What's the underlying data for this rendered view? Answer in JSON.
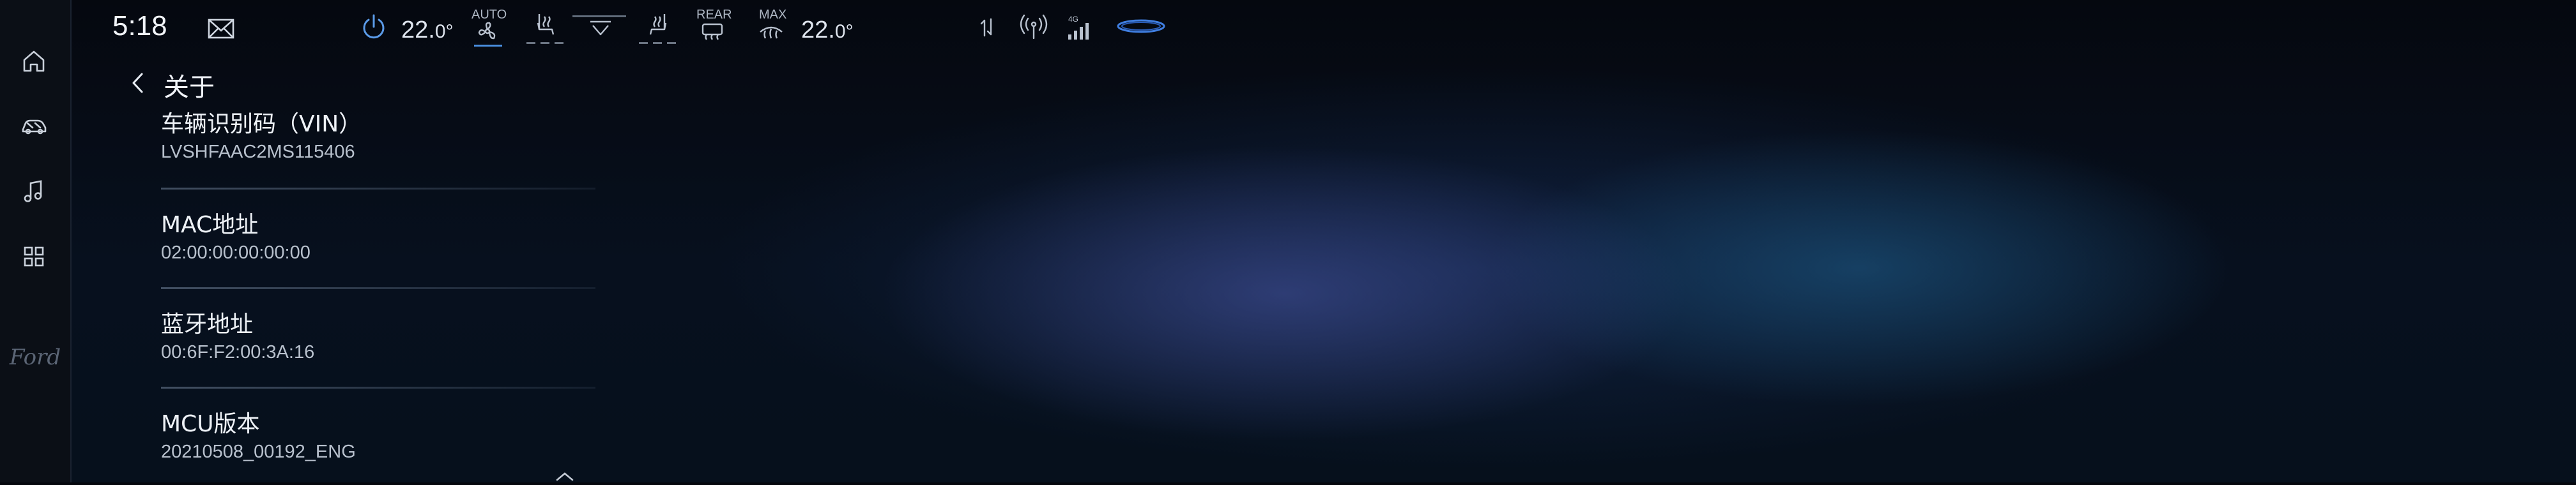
{
  "status_bar": {
    "time": "5:18",
    "mail_icon": "mail-icon",
    "power_icon": "power-icon",
    "driver_temp_main": "22.",
    "driver_temp_decimal": "0°",
    "auto_label": "AUTO",
    "rear_label": "REAR",
    "max_label": "MAX",
    "passenger_temp_main": "22.",
    "passenger_temp_decimal": "0°",
    "accent_color": "#4a8fe0"
  },
  "sidebar": {
    "items": [
      {
        "name": "home",
        "icon": "home-icon"
      },
      {
        "name": "vehicle",
        "icon": "car-icon"
      },
      {
        "name": "media",
        "icon": "music-icon"
      },
      {
        "name": "apps",
        "icon": "grid-icon"
      }
    ],
    "brand": "Ford"
  },
  "page": {
    "title": "关于",
    "items": [
      {
        "title": "车辆识别码（VIN）",
        "value": "LVSHFAAC2MS115406"
      },
      {
        "title": "MAC地址",
        "value": "02:00:00:00:00:00"
      },
      {
        "title": "蓝牙地址",
        "value": "00:6F:F2:00:3A:16"
      },
      {
        "title": "MCU版本",
        "value": "20210508_00192_ENG"
      }
    ]
  }
}
